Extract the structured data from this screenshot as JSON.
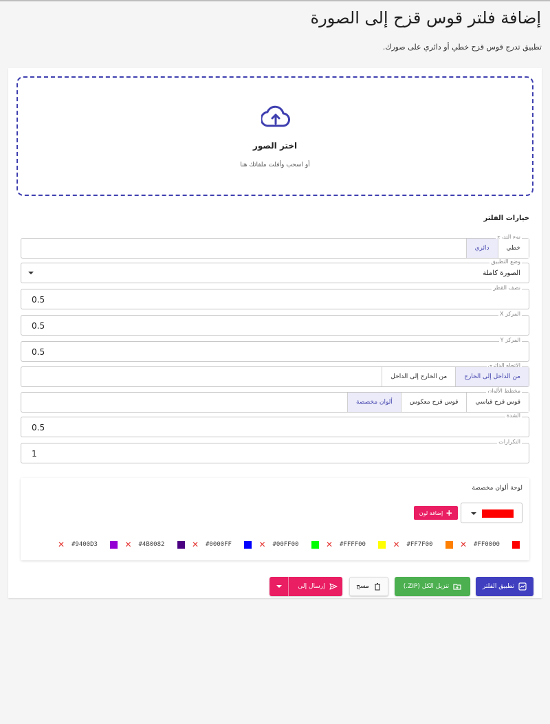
{
  "page": {
    "title": "إضافة فلتر قوس قزح إلى الصورة",
    "subtitle": "تطبيق تدرج قوس قزح خطي أو دائري على صورك."
  },
  "dropzone": {
    "title": "اختر الصور",
    "hint": "أو اسحب وأفلت ملفاتك هنا"
  },
  "filter_options": {
    "section_title": "خيارات الفلتر",
    "gradient_type": {
      "label": "نوع التدرج",
      "options": [
        "خطي",
        "دائري"
      ],
      "selected": "دائري"
    },
    "apply_mode": {
      "label": "وضع التطبيق",
      "value": "الصورة كاملة"
    },
    "radius": {
      "label": "نصف القطر",
      "value": "0.5"
    },
    "center_x": {
      "label": "المركز X",
      "value": "0.5"
    },
    "center_y": {
      "label": "المركز Y",
      "value": "0.5"
    },
    "radial_direction": {
      "label": "الاتجاه الدائري",
      "options": [
        "من الداخل إلى الخارج",
        "من الخارج إلى الداخل"
      ],
      "selected": "من الداخل إلى الخارج"
    },
    "color_scheme": {
      "label": "مخطط الألوان",
      "options": [
        "قوس قزح قياسي",
        "قوس قزح معكوس",
        "ألوان مخصصة"
      ],
      "selected": "ألوان مخصصة"
    },
    "intensity": {
      "label": "الشدة",
      "value": "0.5"
    },
    "repetitions": {
      "label": "التكرارات",
      "value": "1"
    }
  },
  "custom_palette": {
    "title": "لوحة ألوان مخصصة",
    "selected_color": "#FF0000",
    "add_label": "إضافة لون",
    "colors": [
      {
        "hex": "#FF0000",
        "color": "#ff0000"
      },
      {
        "hex": "#FF7F00",
        "color": "#ff7f00"
      },
      {
        "hex": "#FFFF00",
        "color": "#ffff00"
      },
      {
        "hex": "#00FF00",
        "color": "#00ff00"
      },
      {
        "hex": "#0000FF",
        "color": "#0000ff"
      },
      {
        "hex": "#4B0082",
        "color": "#4b0082"
      },
      {
        "hex": "#9400D3",
        "color": "#9400d3"
      }
    ]
  },
  "actions": {
    "apply": "تطبيق الفلتر",
    "download_all": "تنزيل الكل (ZIP.)",
    "clear": "مسح",
    "send_to": "إرسال إلى"
  }
}
